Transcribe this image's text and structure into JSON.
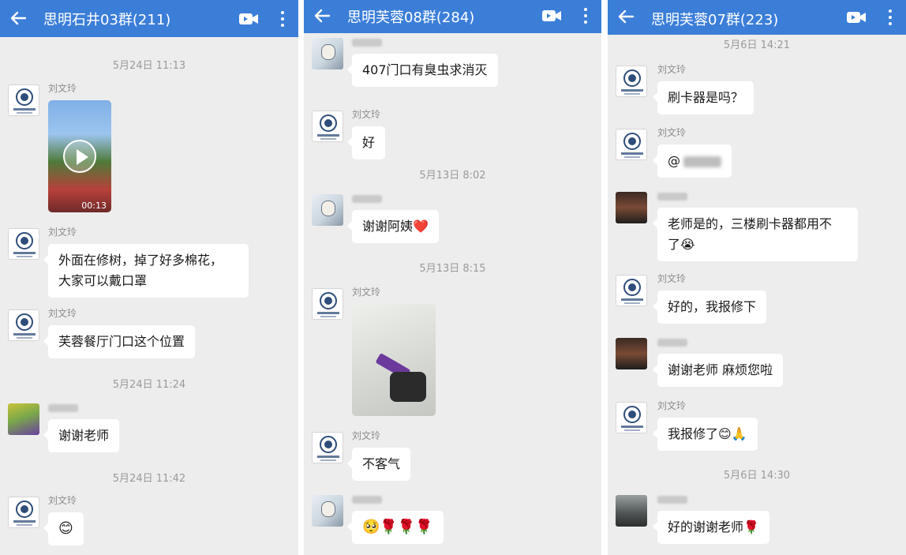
{
  "panels": [
    {
      "title": "思明石井03群(211)",
      "timestamps": [
        "5月24日  11:13",
        "5月24日  11:24",
        "5月24日  11:42"
      ],
      "messages": [
        {
          "sender": "刘文玲",
          "type": "video",
          "duration": "00:13"
        },
        {
          "sender": "刘文玲",
          "line1": "外面在修树，掉了好多棉花，",
          "line2": "大家可以戴口罩"
        },
        {
          "sender": "刘文玲",
          "text": "芙蓉餐厅门口这个位置"
        },
        {
          "sender": "",
          "text": "谢谢老师"
        },
        {
          "sender": "刘文玲",
          "text": "😊"
        }
      ]
    },
    {
      "title": "思明芙蓉08群(284)",
      "timestamps": [
        "5月13日  8:02",
        "5月13日  8:15"
      ],
      "messages": [
        {
          "sender": "",
          "text": "407门口有臭虫求消灭"
        },
        {
          "sender": "刘文玲",
          "text": "好"
        },
        {
          "sender": "",
          "text": "谢谢阿姨❤️"
        },
        {
          "sender": "刘文玲",
          "type": "photo"
        },
        {
          "sender": "刘文玲",
          "text": "不客气"
        },
        {
          "sender": "",
          "text": "🥺🌹🌹🌹"
        }
      ]
    },
    {
      "title": "思明芙蓉07群(223)",
      "timestamps": [
        "5月6日  14:21",
        "5月6日  14:30"
      ],
      "messages": [
        {
          "sender": "刘文玲",
          "text": "刷卡器是吗？"
        },
        {
          "sender": "刘文玲",
          "text": "@"
        },
        {
          "sender": "",
          "line1": "老师是的，三楼刷卡器都用不",
          "line2": "了😭"
        },
        {
          "sender": "刘文玲",
          "text": "好的，我报修下"
        },
        {
          "sender": "",
          "text": "谢谢老师 麻烦您啦"
        },
        {
          "sender": "刘文玲",
          "text": "我报修了😊🙏"
        },
        {
          "sender": "",
          "text": "好的谢谢老师🌹"
        }
      ]
    }
  ],
  "icons": {
    "back": "arrow-left-icon",
    "video_call": "video-camera-icon",
    "more": "more-vertical-icon"
  },
  "colors": {
    "header": "#3b7ed8",
    "background": "#ededed",
    "bubble": "#ffffff",
    "timestamp": "#9a9a9a"
  }
}
